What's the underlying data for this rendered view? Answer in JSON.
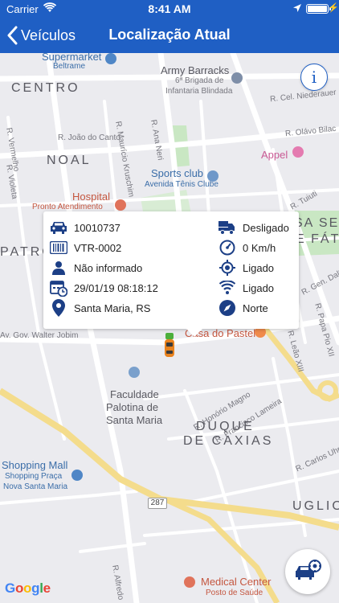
{
  "status_bar": {
    "carrier": "Carrier",
    "time": "8:41 AM"
  },
  "nav": {
    "back_label": "Veículos",
    "title": "Localização Atual"
  },
  "map_labels": {
    "supermarket": "Supermarket",
    "beltrame": "Beltrame",
    "army": "Army Barracks",
    "brigada": "6ª Brigada de",
    "infantaria": "Infantaria Blindada",
    "centro": "CENTRO",
    "vermelho": "R. Vermelho",
    "ana_neri": "R. Ana Neri",
    "cel_niederauer": "R. Cel. Niederauer",
    "olavo_bilac": "R. Olávo Bilac",
    "noal": "NOAL",
    "joao_do_canto": "R. João do Canto",
    "kruschim": "R. Maurício Kruschim",
    "appel": "Appel",
    "violeta": "R. Violeta",
    "hospital": "Hospital",
    "pronto": "Pronto Atendimento",
    "sports": "Sports club",
    "tenis": "Avenida Tênis Clube",
    "tuiuti": "R. Tuiuti",
    "nossa_sen": "SA SEN",
    "de_fati": "E FÁTI",
    "patro": "PATRO",
    "gen_dalto": "R. Gen. Dalto Fil",
    "av_gov": "Av. Gov. Walter Jobim",
    "casa_pastel": "Casa do Pastel",
    "papa_pio": "R. Papa Pio XII",
    "leao": "R. Leão XIII",
    "faculdade1": "Faculdade",
    "faculdade2": "Palotina de",
    "faculdade3": "Santa Maria",
    "honorio": "R. Honório Magno",
    "francisco": "R. Francisco Lameira",
    "duque1": "DUQUE",
    "duque2": "DE CAXIAS",
    "carlos_uhr": "R. Carlos Uhr",
    "shopping_mall": "Shopping Mall",
    "shopping_praca": "Shopping Praça",
    "nova_sm": "Nova Santa Maria",
    "road_287": "287",
    "ugliones": "UGLION",
    "alfredo": "R. Alfredo",
    "medical": "Medical Center",
    "posto": "Posto de Saúde",
    "google": "Google"
  },
  "vehicle_info": {
    "id": "10010737",
    "plate": "VTR-0002",
    "driver": "Não informado",
    "datetime": "29/01/19 08:18:12",
    "city": "Santa Maria, RS",
    "ignition": "Desligado",
    "speed": "0 Km/h",
    "gps": "Ligado",
    "signal": "Ligado",
    "direction": "Norte"
  },
  "colors": {
    "primary": "#1f5fc4",
    "map_bg": "#ebebef",
    "road": "#ffffff",
    "highway": "#f4dc8c",
    "park": "#c9e7c3"
  },
  "icons": {
    "info": "info-icon",
    "car": "car-icon",
    "barcode": "barcode-icon",
    "person": "person-icon",
    "calendar": "calendar-clock-icon",
    "pin": "map-pin-icon",
    "truck": "truck-icon",
    "speed": "speedometer-icon",
    "gps": "gps-icon",
    "wifi": "signal-icon",
    "compass": "compass-icon",
    "fab": "vehicle-location-icon"
  }
}
